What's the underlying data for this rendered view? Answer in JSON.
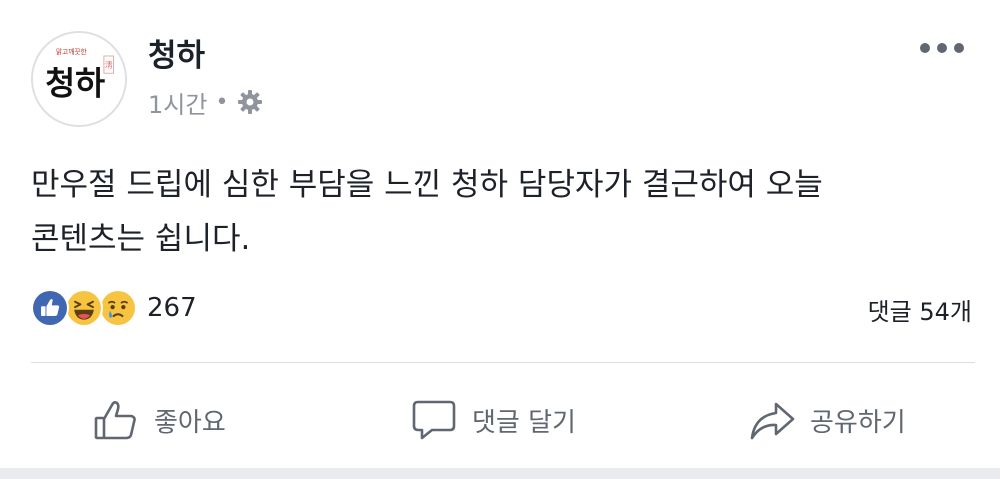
{
  "post": {
    "page_name": "청하",
    "timestamp": "1시간",
    "separator": "•",
    "privacy_icon": "gear-icon",
    "avatar_logo_text": "청하",
    "avatar_small_text": "맑고깨끗한",
    "avatar_stamp_text": "淸",
    "more_icon": "more-horizontal-icon",
    "message_line1": "만우절 드립에 심한 부담을 느낀 청하 담당자가 결근하여 오늘",
    "message_line2": "콘텐츠는 쉽니다."
  },
  "reactions": {
    "icons": [
      "like-reaction-icon",
      "haha-reaction-icon",
      "sad-reaction-icon"
    ],
    "count": "267",
    "comment_count": "댓글 54개"
  },
  "actions": {
    "like_label": "좋아요",
    "comment_label": "댓글 달기",
    "share_label": "공유하기"
  },
  "colors": {
    "like_blue": "#4267b2",
    "emoji_yellow": "#f7c441",
    "secondary_text": "#90949c",
    "action_text": "#606770"
  }
}
